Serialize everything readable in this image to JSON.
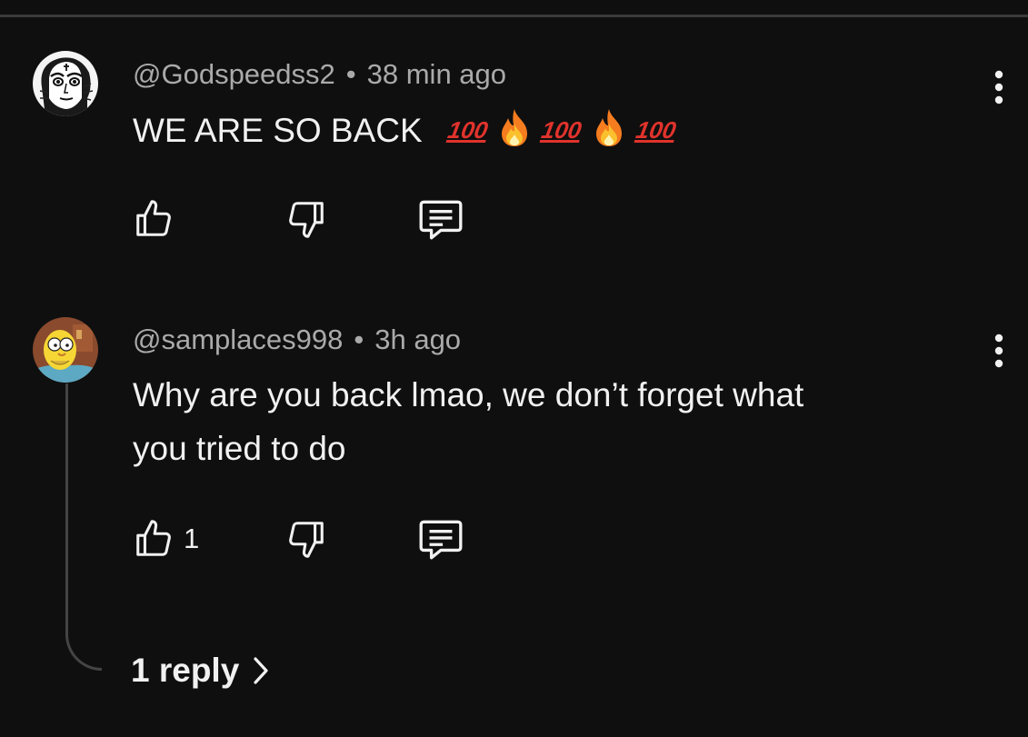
{
  "comments": [
    {
      "handle": "@Godspeedss2",
      "separator": "•",
      "time": "38 min ago",
      "text": "WE ARE SO BACK",
      "emoji_hundred": "100",
      "like_count": ""
    },
    {
      "handle": "@samplaces998",
      "separator": "•",
      "time": "3h ago",
      "text_line1": "Why are you back lmao, we don’t forget what",
      "text_line2": "you tried to do",
      "like_count": "1"
    }
  ],
  "replies": {
    "label": "1 reply"
  },
  "icons": {
    "like": "thumbs-up-icon",
    "dislike": "thumbs-down-icon",
    "reply": "comment-icon",
    "more": "more-vertical-icon",
    "chevron": "chevron-right-icon"
  },
  "colors": {
    "background": "#0f0f0f",
    "text": "#f1f1f1",
    "muted": "#aaaaaa",
    "hundred_emoji": "#e0332c"
  }
}
